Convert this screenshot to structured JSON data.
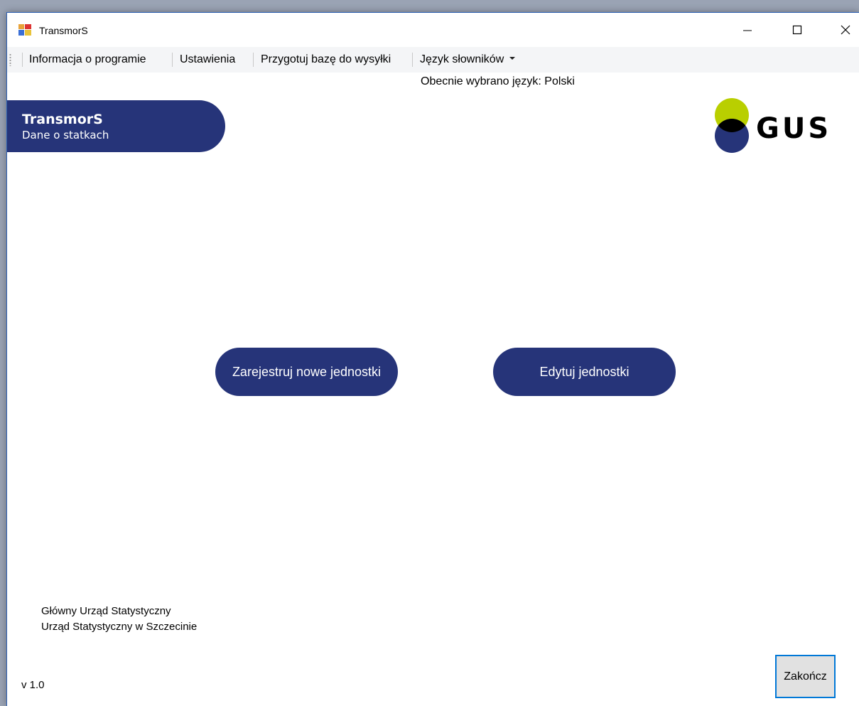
{
  "window": {
    "title": "TransmorS"
  },
  "menu": {
    "items": [
      {
        "label": "Informacja o programie"
      },
      {
        "label": "Ustawienia"
      },
      {
        "label": "Przygotuj bazę do wysyłki"
      },
      {
        "label": "Język słowników"
      }
    ]
  },
  "language_status": "Obecnie wybrano język: Polski",
  "banner": {
    "title": "TransmorS",
    "subtitle": "Dane o statkach"
  },
  "logo": {
    "text": "GUS",
    "colors": {
      "top_circle": "#b9cf00",
      "bottom_circle": "#263479",
      "lens": "#000000"
    }
  },
  "actions": {
    "register_label": "Zarejestruj nowe jednostki",
    "edit_label": "Edytuj jednostki"
  },
  "footer": {
    "line1": "Główny Urząd Statystyczny",
    "line2": "Urząd Statystyczny w Szczecinie",
    "version": "v 1.0"
  },
  "exit_label": "Zakończ",
  "theme": {
    "accent": "#263479",
    "focus_border": "#0078d7"
  }
}
